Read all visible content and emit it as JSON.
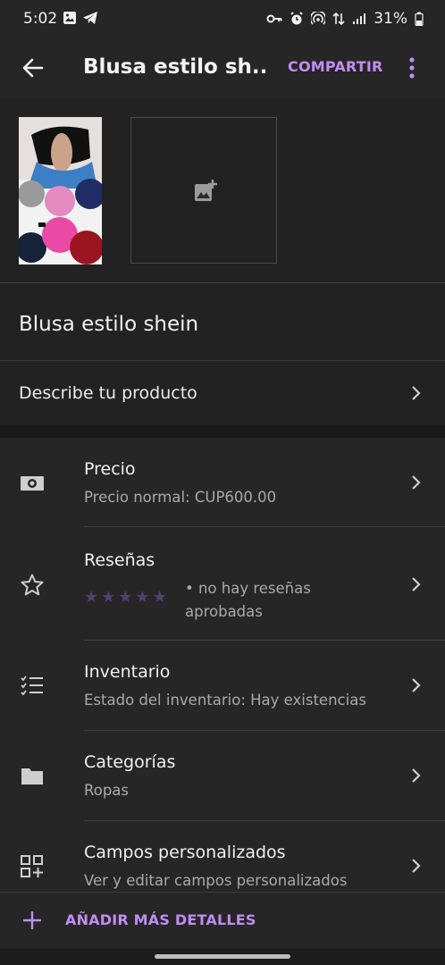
{
  "status_bar": {
    "time": "5:02",
    "battery": "31%"
  },
  "app_bar": {
    "title": "Blusa estilo sh...",
    "share_label": "COMPARTIR"
  },
  "product": {
    "name": "Blusa estilo shein",
    "describe_label": "Describe tu producto"
  },
  "details": [
    {
      "title": "Precio",
      "subtitle": "Precio normal: CUP600.00",
      "icon": "banknote-icon"
    },
    {
      "title": "Reseñas",
      "subtitle": "• no hay reseñas aprobadas",
      "icon": "star-outline-icon",
      "rating": 0
    },
    {
      "title": "Inventario",
      "subtitle": "Estado del inventario: Hay existencias",
      "icon": "checklist-icon"
    },
    {
      "title": "Categorías",
      "subtitle": "Ropas",
      "icon": "folder-icon"
    },
    {
      "title": "Campos personalizados",
      "subtitle": "Ver y editar campos personalizados",
      "icon": "custom-fields-icon"
    }
  ],
  "bottom_action": {
    "label": "AÑADIR MÁS DETALLES"
  },
  "colors": {
    "accent": "#c18cf2",
    "background": "#262626",
    "star_empty": "#4f4270"
  }
}
